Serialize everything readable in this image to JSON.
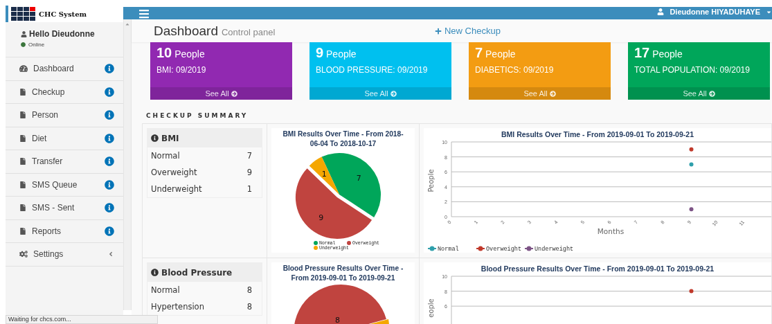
{
  "logo": {
    "text": "CHC System"
  },
  "user_panel": {
    "greeting": "Hello Dieudonne",
    "status": "Online",
    "online": true
  },
  "sidebar": {
    "items": [
      {
        "label": "Dashboard",
        "kind": "dashboard"
      },
      {
        "label": "Checkup",
        "kind": "page"
      },
      {
        "label": "Person",
        "kind": "page"
      },
      {
        "label": "Diet",
        "kind": "page"
      },
      {
        "label": "Transfer",
        "kind": "page"
      },
      {
        "label": "SMS Queue",
        "kind": "page"
      },
      {
        "label": "SMS - Sent",
        "kind": "page"
      },
      {
        "label": "Reports",
        "kind": "page"
      },
      {
        "label": "Settings",
        "kind": "settings"
      }
    ]
  },
  "navbar": {
    "user": "Dieudonne HIYADUHAYE"
  },
  "header": {
    "title": "Dashboard",
    "subtitle": "Control panel",
    "action": "New Checkup"
  },
  "cards": [
    {
      "count": "10",
      "unit": "People",
      "caption": "BMI: 09/2019",
      "link": "See All",
      "color": "#9129b1"
    },
    {
      "count": "9",
      "unit": "People",
      "caption": "BLOOD PRESSURE: 09/2019",
      "link": "See All",
      "color": "#00c0ef"
    },
    {
      "count": "7",
      "unit": "People",
      "caption": "DIABETICS: 09/2019",
      "link": "See All",
      "color": "#f39c12"
    },
    {
      "count": "17",
      "unit": "People",
      "caption": "TOTAL POPULATION: 09/2019",
      "link": "See All",
      "color": "#00a65a"
    }
  ],
  "summary_title": "CHECKUP SUMMARY",
  "summary": [
    {
      "table": {
        "title": "BMI",
        "rows": [
          {
            "label": "Normal",
            "value": "7"
          },
          {
            "label": "Overweight",
            "value": "9"
          },
          {
            "label": "Underweight",
            "value": "1"
          }
        ]
      },
      "pie": {
        "chart_data": {
          "type": "pie",
          "title": "BMI Results Over Time  - From 2018-06-04 To 2018-10-17",
          "categories": [
            "Normal",
            "Overweight",
            "Underweight"
          ],
          "values": [
            7,
            9,
            1
          ],
          "data_labels": true,
          "legend": true
        }
      },
      "line": {
        "chart_data": {
          "type": "scatter",
          "title": "BMI Results Over Time  - From 2019-09-01 To 2019-09-21",
          "xlabel": "Months",
          "ylabel": "People",
          "x": [
            9
          ],
          "series": [
            {
              "name": "Normal",
              "color": "#2f9fab",
              "values": [
                7
              ]
            },
            {
              "name": "Overweight",
              "color": "#c0392b",
              "values": [
                9
              ]
            },
            {
              "name": "Underweight",
              "color": "#7d5486",
              "values": [
                1
              ]
            }
          ],
          "xlim": [
            0,
            12
          ],
          "ylim": [
            0,
            10
          ],
          "xticks": [
            0,
            1,
            2,
            3,
            4,
            5,
            6,
            7,
            8,
            9,
            10,
            11
          ],
          "yticks": [
            0,
            2,
            4,
            6,
            8,
            10
          ],
          "grid": true,
          "legend": true
        }
      }
    },
    {
      "table": {
        "title": "Blood Pressure",
        "rows": [
          {
            "label": "Normal",
            "value": "8"
          },
          {
            "label": "Hypertension",
            "value": "8"
          }
        ]
      },
      "pie": {
        "title": "Blood Pressure Results Over Time  - From 2019-09-01 To 2019-09-21",
        "slice_label": "8"
      },
      "line": {
        "chart_data": {
          "type": "scatter",
          "title": "Blood Pressure Results Over Time  - From 2019-09-01 To 2019-09-21",
          "ylabel": "eople",
          "x": [
            9
          ],
          "series": [
            {
              "color": "#c0392b",
              "values": [
                8
              ]
            }
          ],
          "xlim": [
            0,
            12
          ],
          "ylim": [
            0,
            10
          ],
          "yticks": [
            6,
            8,
            10
          ],
          "grid": true
        }
      }
    }
  ],
  "status_bar": {
    "text": "Waiting for chcs.com..."
  }
}
